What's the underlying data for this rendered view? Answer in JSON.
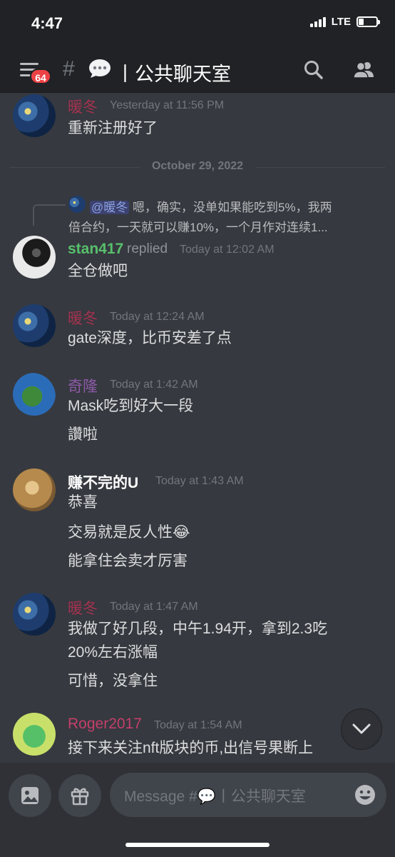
{
  "status": {
    "time": "4:47",
    "network": "LTE"
  },
  "header": {
    "badge_count": "64",
    "hash": "#",
    "channel_name": "丨公共聊天室"
  },
  "messages": {
    "m1": {
      "author": "暖冬",
      "time": "Yesterday at 11:56 PM",
      "lines": [
        "重新注册好了"
      ]
    },
    "date_divider": "October 29, 2022",
    "m2": {
      "reply_mention": "@暖冬",
      "reply_line1": "嗯，确实，没单如果能吃到5%，我两",
      "reply_line2": "倍合约，一天就可以赚10%，一个月作对连续1...",
      "author": "stan417",
      "replied": "replied",
      "time": "Today at 12:02 AM",
      "lines": [
        "全仓做吧"
      ]
    },
    "m3": {
      "author": "暖冬",
      "time": "Today at 12:24 AM",
      "lines": [
        "gate深度，比币安差了点"
      ]
    },
    "m4": {
      "author": "奇隆",
      "time": "Today at 1:42 AM",
      "lines": [
        "Mask吃到好大一段",
        "讚啦"
      ]
    },
    "m5": {
      "author": "赚不完的U",
      "time": "Today at 1:43 AM",
      "lines": [
        "恭喜",
        "交易就是反人性😂",
        "能拿住会卖才厉害"
      ]
    },
    "m6": {
      "author": "暖冬",
      "time": "Today at 1:47 AM",
      "lines": [
        "我做了好几段，中午1.94开，拿到2.3吃",
        "20%左右涨幅",
        "可惜，没拿住"
      ]
    },
    "m7": {
      "author": "Roger2017",
      "time": "Today at 1:54 AM",
      "lines": [
        "接下来关注nft版块的币,出信号果断上"
      ]
    }
  },
  "composer": {
    "placeholder": "Message #💬丨公共聊天室"
  },
  "colors": {
    "background": "#36393f",
    "header": "#202225",
    "name_nuandong": "#a3324f",
    "name_stan": "#57c06c",
    "name_qilong": "#8d5aa8",
    "name_roger": "#c43f6a",
    "mention_bg": "#3c4270",
    "badge": "#ed4245"
  },
  "icons": [
    "menu-icon",
    "search-icon",
    "members-icon",
    "chevron-down-icon",
    "image-icon",
    "gift-icon",
    "emoji-icon"
  ]
}
